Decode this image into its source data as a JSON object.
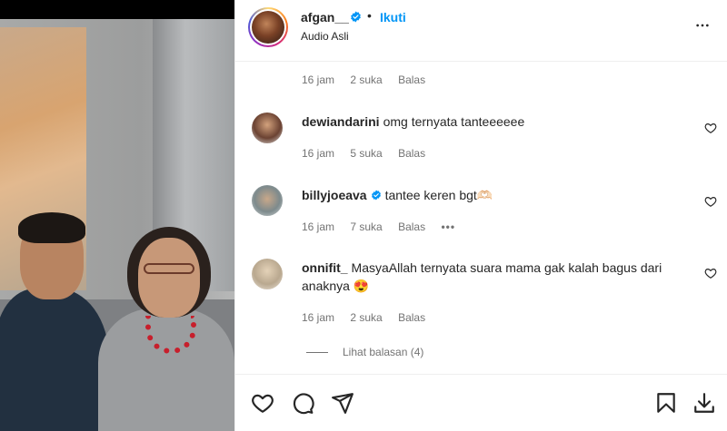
{
  "post": {
    "username": "afgan__",
    "separator": "•",
    "follow_label": "Ikuti",
    "audio_label": "Audio Asli"
  },
  "comments": [
    {
      "username": "",
      "text": "",
      "time": "16 jam",
      "likes": "2 suka",
      "reply_label": "Balas",
      "verified": false
    },
    {
      "username": "dewiandarini",
      "text": "omg ternyata tanteeeeee",
      "time": "16 jam",
      "likes": "5 suka",
      "reply_label": "Balas",
      "verified": false
    },
    {
      "username": "billyjoeava",
      "text": "tantee keren bgt🫶🏻",
      "time": "16 jam",
      "likes": "7 suka",
      "reply_label": "Balas",
      "more_label": "•••",
      "verified": true
    },
    {
      "username": "onnifit_",
      "text": "MasyaAllah ternyata suara mama gak kalah bagus dari anaknya 😍",
      "time": "16 jam",
      "likes": "2 suka",
      "reply_label": "Balas",
      "verified": false
    }
  ],
  "view_replies_label": "Lihat balasan (4)",
  "icons": {
    "more": "more-horizontal-icon",
    "verified": "verified-badge-icon",
    "like": "heart-icon",
    "comment": "comment-icon",
    "share": "paper-plane-icon",
    "save": "bookmark-icon",
    "download": "download-icon"
  },
  "colors": {
    "accent": "#0095f6",
    "text": "#262626",
    "secondary": "#737373"
  }
}
